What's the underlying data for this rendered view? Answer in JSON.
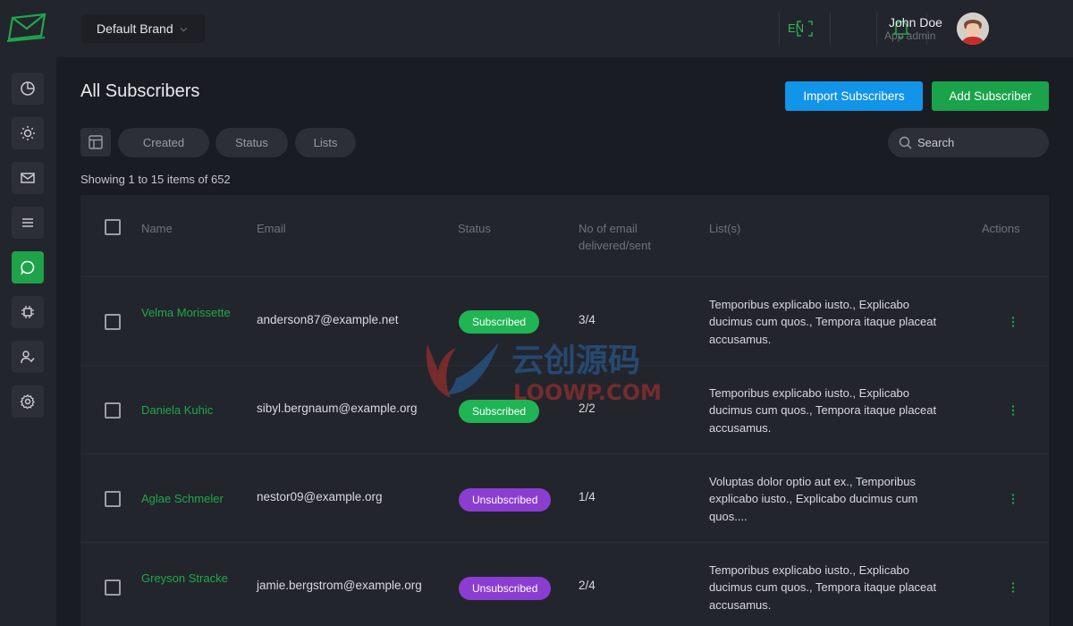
{
  "brand": {
    "label": "Default Brand"
  },
  "header": {
    "lang": "EN",
    "user_name": "John Doe",
    "user_role": "App admin"
  },
  "page": {
    "title": "All Subscribers",
    "import_label": "Import Subscribers",
    "add_label": "Add Subscriber"
  },
  "filters": {
    "created": "Created",
    "status": "Status",
    "lists": "Lists",
    "search_placeholder": "Search"
  },
  "showing": "Showing 1 to 15 items of 652",
  "table": {
    "headers": {
      "name": "Name",
      "email": "Email",
      "status": "Status",
      "delivered": "No of email delivered/sent",
      "lists": "List(s)",
      "actions": "Actions"
    },
    "rows": [
      {
        "name": "Velma Morissette",
        "email": "anderson87@example.net",
        "status": "Subscribed",
        "delivered": "3/4",
        "lists": "Temporibus explicabo iusto., Explicabo ducimus cum quos., Tempora itaque placeat accusamus."
      },
      {
        "name": "Daniela Kuhic",
        "email": "sibyl.bergnaum@example.org",
        "status": "Subscribed",
        "delivered": "2/2",
        "lists": "Temporibus explicabo iusto., Explicabo ducimus cum quos., Tempora itaque placeat accusamus."
      },
      {
        "name": "Aglae Schmeler",
        "email": "nestor09@example.org",
        "status": "Unsubscribed",
        "delivered": "1/4",
        "lists": "Voluptas dolor optio aut ex., Temporibus explicabo iusto., Explicabo ducimus cum quos...."
      },
      {
        "name": "Greyson Stracke",
        "email": "jamie.bergstrom@example.org",
        "status": "Unsubscribed",
        "delivered": "2/4",
        "lists": "Temporibus explicabo iusto., Explicabo ducimus cum quos., Tempora itaque placeat accusamus."
      }
    ]
  },
  "watermark": {
    "cn": "云创源码",
    "en": "LOOWP.COM"
  },
  "colors": {
    "accent": "#1fa74c",
    "import": "#1294e8",
    "subscribed": "#1fb554",
    "unsubscribed": "#8b3dd2"
  }
}
